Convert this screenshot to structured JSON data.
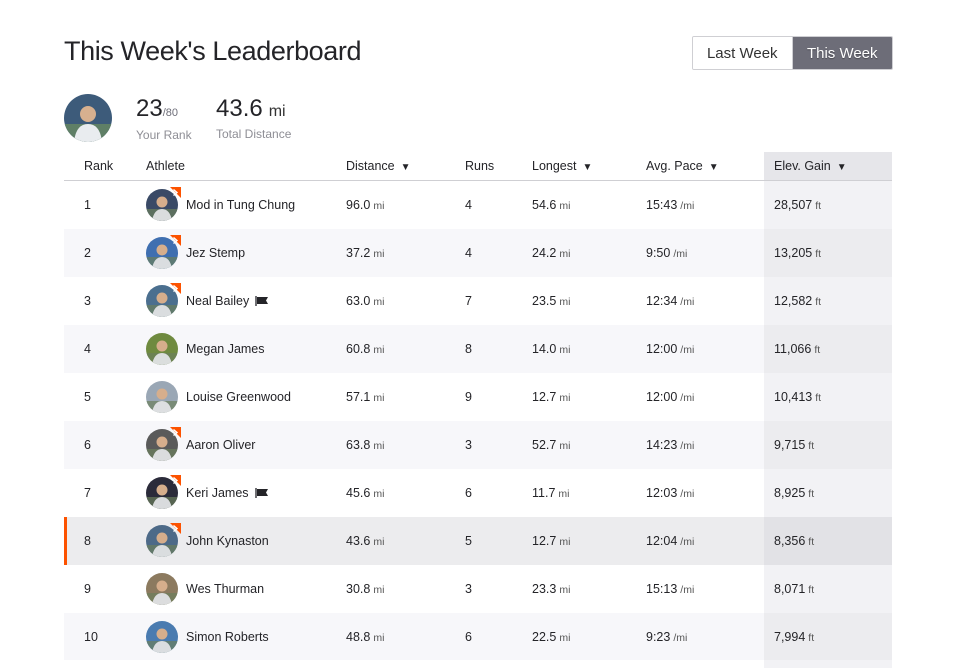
{
  "header": {
    "title": "This Week's Leaderboard"
  },
  "toggle": {
    "last_week": "Last Week",
    "this_week": "This Week",
    "selected": "This Week"
  },
  "summary": {
    "rank": "23",
    "rank_total": "/80",
    "rank_label": "Your Rank",
    "distance": "43.6",
    "distance_unit": "mi",
    "distance_label": "Total Distance"
  },
  "table": {
    "columns": {
      "rank": "Rank",
      "athlete": "Athlete",
      "distance": "Distance",
      "runs": "Runs",
      "longest": "Longest",
      "pace": "Avg. Pace",
      "elev": "Elev. Gain"
    },
    "sorted_by": "Elev. Gain",
    "units": {
      "mi": "mi",
      "pace": "/mi",
      "ft": "ft"
    },
    "rows": [
      {
        "rank": "1",
        "name": "Mod in Tung Chung",
        "distance": "96.0",
        "runs": "4",
        "longest": "54.6",
        "pace": "15:43",
        "elev": "28,507",
        "subscriber": true,
        "flag": false,
        "avatar_color": "#3a4a66"
      },
      {
        "rank": "2",
        "name": "Jez Stemp",
        "distance": "37.2",
        "runs": "4",
        "longest": "24.2",
        "pace": "9:50",
        "elev": "13,205",
        "subscriber": true,
        "flag": false,
        "avatar_color": "#3f6fb0"
      },
      {
        "rank": "3",
        "name": "Neal Bailey",
        "distance": "63.0",
        "runs": "7",
        "longest": "23.5",
        "pace": "12:34",
        "elev": "12,582",
        "subscriber": true,
        "flag": true,
        "avatar_color": "#4b6f8f"
      },
      {
        "rank": "4",
        "name": "Megan James",
        "distance": "60.8",
        "runs": "8",
        "longest": "14.0",
        "pace": "12:00",
        "elev": "11,066",
        "subscriber": false,
        "flag": false,
        "avatar_color": "#6f8a3f"
      },
      {
        "rank": "5",
        "name": "Louise Greenwood",
        "distance": "57.1",
        "runs": "9",
        "longest": "12.7",
        "pace": "12:00",
        "elev": "10,413",
        "subscriber": false,
        "flag": false,
        "avatar_color": "#9aa7b5"
      },
      {
        "rank": "6",
        "name": "Aaron Oliver",
        "distance": "63.8",
        "runs": "3",
        "longest": "52.7",
        "pace": "14:23",
        "elev": "9,715",
        "subscriber": true,
        "flag": false,
        "avatar_color": "#5a5a5a"
      },
      {
        "rank": "7",
        "name": "Keri James",
        "distance": "45.6",
        "runs": "6",
        "longest": "11.7",
        "pace": "12:03",
        "elev": "8,925",
        "subscriber": true,
        "flag": true,
        "avatar_color": "#2b2b3a"
      },
      {
        "rank": "8",
        "name": "John Kynaston",
        "distance": "43.6",
        "runs": "5",
        "longest": "12.7",
        "pace": "12:04",
        "elev": "8,356",
        "subscriber": true,
        "flag": false,
        "avatar_color": "#4d6a88",
        "current_user": true
      },
      {
        "rank": "9",
        "name": "Wes Thurman",
        "distance": "30.8",
        "runs": "3",
        "longest": "23.3",
        "pace": "15:13",
        "elev": "8,071",
        "subscriber": false,
        "flag": false,
        "avatar_color": "#8c7a5f"
      },
      {
        "rank": "10",
        "name": "Simon Roberts",
        "distance": "48.8",
        "runs": "6",
        "longest": "22.5",
        "pace": "9:23",
        "elev": "7,994",
        "subscriber": false,
        "flag": false,
        "avatar_color": "#4a7bb0"
      }
    ]
  },
  "colors": {
    "accent": "#fc5200",
    "toggle_active": "#6d6d78",
    "sorted_column": "#e6e6ea"
  },
  "icons": {
    "sort": "sort-down-icon",
    "subscriber": "subscriber-badge-icon",
    "flag": "flag-icon"
  }
}
